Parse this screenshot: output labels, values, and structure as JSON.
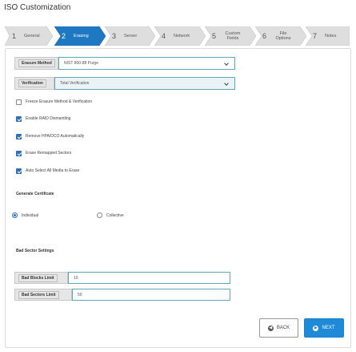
{
  "app": {
    "title": "ISO Customization"
  },
  "wizard": {
    "steps": [
      {
        "number": "1",
        "label": "General",
        "active": false
      },
      {
        "number": "2",
        "label": "Erasing",
        "active": true
      },
      {
        "number": "3",
        "label": "Server",
        "active": false
      },
      {
        "number": "4",
        "label": "Network",
        "active": false
      },
      {
        "number": "5",
        "label": "Custom Fields",
        "active": false
      },
      {
        "number": "6",
        "label": "File Options",
        "active": false
      },
      {
        "number": "7",
        "label": "Notes",
        "active": false
      }
    ]
  },
  "erasing": {
    "erasure_method": {
      "label": "Erasure Method",
      "value": "NIST 800-88 Purge"
    },
    "verification": {
      "label": "Verification",
      "value": "Total Verification"
    },
    "options": [
      {
        "label": "Freeze Erasure Method & Verification",
        "checked": false
      },
      {
        "label": "Enable RAID Dismantling",
        "checked": true
      },
      {
        "label": "Remove HPA/DCO Automatically",
        "checked": true
      },
      {
        "label": "Erase Remapped Sectors",
        "checked": true
      },
      {
        "label": "Auto Select All Media to Erase",
        "checked": true
      }
    ],
    "certificate": {
      "heading": "Generate Certificate",
      "individual": "Individual",
      "collective": "Collective",
      "selected": "individual"
    },
    "bad_sector": {
      "heading": "Bad Sector Settings",
      "blocks_label": "Bad Blocks Limit",
      "blocks_value": "10",
      "sectors_label": "Bad Sectors Limit",
      "sectors_value": "50"
    }
  },
  "footer": {
    "back_label": "BACK",
    "next_label": "NEXT"
  },
  "colors": {
    "accent": "#1e8ad8",
    "step_active": "#1e78c2",
    "step_inactive": "#dedede",
    "field_border": "#5fa8b8"
  }
}
